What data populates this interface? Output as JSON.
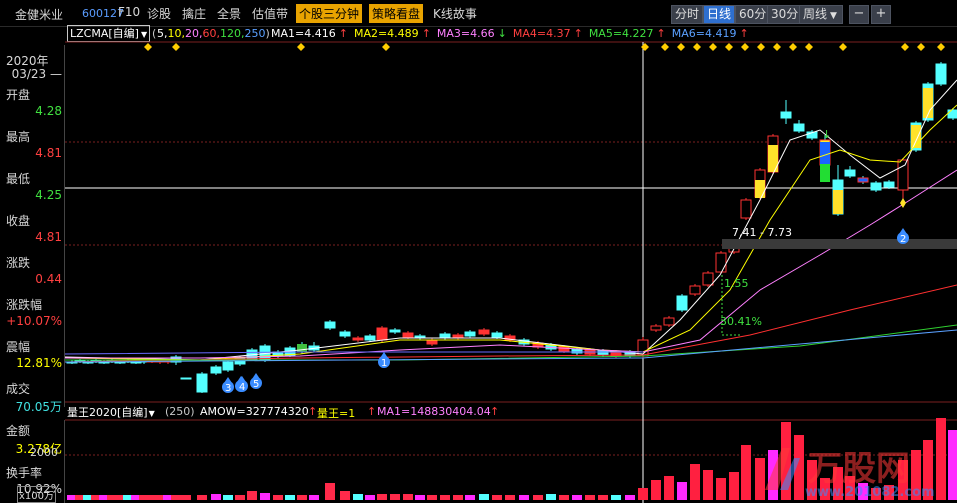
{
  "header": {
    "stock_name": "金健米业",
    "stock_code": "600127",
    "buttons": [
      {
        "label": "F10",
        "style": "plain"
      },
      {
        "label": "诊股",
        "style": "plain"
      },
      {
        "label": "擒庄",
        "style": "plain"
      },
      {
        "label": "全景",
        "style": "plain"
      },
      {
        "label": "估值带",
        "style": "plain"
      },
      {
        "label": "个股三分钟",
        "style": "highlight"
      },
      {
        "label": "策略看盘",
        "style": "highlight"
      },
      {
        "label": "K线故事",
        "style": "plain"
      }
    ],
    "periods": [
      {
        "label": "分时",
        "active": false
      },
      {
        "label": "日线",
        "active": true
      },
      {
        "label": "60分",
        "active": false
      },
      {
        "label": "30分",
        "active": false
      },
      {
        "label": "周线",
        "active": false
      }
    ]
  },
  "ma_legend": {
    "indicator": "LZCMA[自编]",
    "params_prefix": "(",
    "params": [
      {
        "text": "5,",
        "color": "#ffffff"
      },
      {
        "text": "10,",
        "color": "#ffff00"
      },
      {
        "text": "20,",
        "color": "#ff80ff"
      },
      {
        "text": "60,",
        "color": "#ff4040"
      },
      {
        "text": "120,",
        "color": "#40e040"
      },
      {
        "text": "250",
        "color": "#5aa0ff"
      }
    ],
    "params_suffix": ")",
    "items": [
      {
        "text": "MA1=4.416",
        "color": "#ffffff",
        "arrow": "↑",
        "arrow_color": "#ff4040"
      },
      {
        "text": "MA2=4.489",
        "color": "#ffff00",
        "arrow": "↑",
        "arrow_color": "#ff4040"
      },
      {
        "text": "MA3=4.66",
        "color": "#ff80ff",
        "arrow": "↓",
        "arrow_color": "#40e040"
      },
      {
        "text": "MA4=4.37",
        "color": "#ff4040",
        "arrow": "↑",
        "arrow_color": "#ff4040"
      },
      {
        "text": "MA5=4.227",
        "color": "#40e040",
        "arrow": "↑",
        "arrow_color": "#ff4040"
      },
      {
        "text": "MA6=4.419",
        "color": "#5aa0ff",
        "arrow": "↑",
        "arrow_color": "#ff4040"
      }
    ]
  },
  "quote_panel": {
    "year": "2020年",
    "date": "03/23",
    "rows": [
      {
        "label": "开盘",
        "value": "4.28",
        "color": "#40e040"
      },
      {
        "label": "最高",
        "value": "4.81",
        "color": "#ff4040"
      },
      {
        "label": "最低",
        "value": "4.25",
        "color": "#40e040"
      },
      {
        "label": "收盘",
        "value": "4.81",
        "color": "#ff4040"
      },
      {
        "label": "涨跌",
        "value": "0.44",
        "color": "#ff4040"
      },
      {
        "label": "涨跌幅",
        "value": "+10.07%",
        "color": "#ff4040"
      },
      {
        "label": "震幅",
        "value": "12.81%",
        "color": "#ffff00"
      },
      {
        "label": "成交",
        "value": "70.05万",
        "color": "#40e0e0"
      },
      {
        "label": "金额",
        "value": "3.278亿",
        "color": "#ffff00"
      },
      {
        "label": "换手率",
        "value": "10.92%",
        "color": "#d8d8d8"
      }
    ]
  },
  "chart_annotations": {
    "range_label": "7.41 - 7.73",
    "ratio_label": "1.55",
    "pct_label": "30.41%",
    "signals": [
      "1",
      "2",
      "3",
      "1",
      "4",
      "5"
    ]
  },
  "indicator_panel": {
    "name": "量王2020[自编]",
    "params": "(250)",
    "amow": "AMOW=327774320",
    "amow_arrow": "↑",
    "lw": "量王=1",
    "lw_arrow": "↑",
    "ma1": "MA1=148830404.04",
    "ma1_arrow": "↑",
    "y_tick": "2000",
    "unit": "x100万"
  },
  "watermark": {
    "text": "万股网",
    "url": "www.201082.com"
  },
  "colors": {
    "up": "#ff3232",
    "down": "#54ffff",
    "highlight": "#e8a300",
    "active_period": "#2e6fcf"
  }
}
